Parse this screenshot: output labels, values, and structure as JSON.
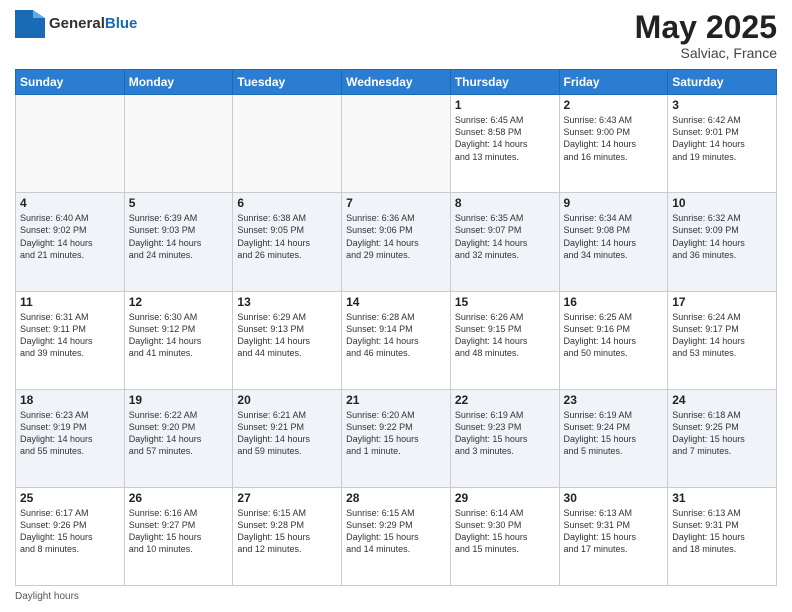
{
  "header": {
    "logo_general": "General",
    "logo_blue": "Blue",
    "month_year": "May 2025",
    "location": "Salviac, France"
  },
  "days_of_week": [
    "Sunday",
    "Monday",
    "Tuesday",
    "Wednesday",
    "Thursday",
    "Friday",
    "Saturday"
  ],
  "footer_text": "Daylight hours",
  "weeks": [
    [
      {
        "num": "",
        "info": ""
      },
      {
        "num": "",
        "info": ""
      },
      {
        "num": "",
        "info": ""
      },
      {
        "num": "",
        "info": ""
      },
      {
        "num": "1",
        "info": "Sunrise: 6:45 AM\nSunset: 8:58 PM\nDaylight: 14 hours\nand 13 minutes."
      },
      {
        "num": "2",
        "info": "Sunrise: 6:43 AM\nSunset: 9:00 PM\nDaylight: 14 hours\nand 16 minutes."
      },
      {
        "num": "3",
        "info": "Sunrise: 6:42 AM\nSunset: 9:01 PM\nDaylight: 14 hours\nand 19 minutes."
      }
    ],
    [
      {
        "num": "4",
        "info": "Sunrise: 6:40 AM\nSunset: 9:02 PM\nDaylight: 14 hours\nand 21 minutes."
      },
      {
        "num": "5",
        "info": "Sunrise: 6:39 AM\nSunset: 9:03 PM\nDaylight: 14 hours\nand 24 minutes."
      },
      {
        "num": "6",
        "info": "Sunrise: 6:38 AM\nSunset: 9:05 PM\nDaylight: 14 hours\nand 26 minutes."
      },
      {
        "num": "7",
        "info": "Sunrise: 6:36 AM\nSunset: 9:06 PM\nDaylight: 14 hours\nand 29 minutes."
      },
      {
        "num": "8",
        "info": "Sunrise: 6:35 AM\nSunset: 9:07 PM\nDaylight: 14 hours\nand 32 minutes."
      },
      {
        "num": "9",
        "info": "Sunrise: 6:34 AM\nSunset: 9:08 PM\nDaylight: 14 hours\nand 34 minutes."
      },
      {
        "num": "10",
        "info": "Sunrise: 6:32 AM\nSunset: 9:09 PM\nDaylight: 14 hours\nand 36 minutes."
      }
    ],
    [
      {
        "num": "11",
        "info": "Sunrise: 6:31 AM\nSunset: 9:11 PM\nDaylight: 14 hours\nand 39 minutes."
      },
      {
        "num": "12",
        "info": "Sunrise: 6:30 AM\nSunset: 9:12 PM\nDaylight: 14 hours\nand 41 minutes."
      },
      {
        "num": "13",
        "info": "Sunrise: 6:29 AM\nSunset: 9:13 PM\nDaylight: 14 hours\nand 44 minutes."
      },
      {
        "num": "14",
        "info": "Sunrise: 6:28 AM\nSunset: 9:14 PM\nDaylight: 14 hours\nand 46 minutes."
      },
      {
        "num": "15",
        "info": "Sunrise: 6:26 AM\nSunset: 9:15 PM\nDaylight: 14 hours\nand 48 minutes."
      },
      {
        "num": "16",
        "info": "Sunrise: 6:25 AM\nSunset: 9:16 PM\nDaylight: 14 hours\nand 50 minutes."
      },
      {
        "num": "17",
        "info": "Sunrise: 6:24 AM\nSunset: 9:17 PM\nDaylight: 14 hours\nand 53 minutes."
      }
    ],
    [
      {
        "num": "18",
        "info": "Sunrise: 6:23 AM\nSunset: 9:19 PM\nDaylight: 14 hours\nand 55 minutes."
      },
      {
        "num": "19",
        "info": "Sunrise: 6:22 AM\nSunset: 9:20 PM\nDaylight: 14 hours\nand 57 minutes."
      },
      {
        "num": "20",
        "info": "Sunrise: 6:21 AM\nSunset: 9:21 PM\nDaylight: 14 hours\nand 59 minutes."
      },
      {
        "num": "21",
        "info": "Sunrise: 6:20 AM\nSunset: 9:22 PM\nDaylight: 15 hours\nand 1 minute."
      },
      {
        "num": "22",
        "info": "Sunrise: 6:19 AM\nSunset: 9:23 PM\nDaylight: 15 hours\nand 3 minutes."
      },
      {
        "num": "23",
        "info": "Sunrise: 6:19 AM\nSunset: 9:24 PM\nDaylight: 15 hours\nand 5 minutes."
      },
      {
        "num": "24",
        "info": "Sunrise: 6:18 AM\nSunset: 9:25 PM\nDaylight: 15 hours\nand 7 minutes."
      }
    ],
    [
      {
        "num": "25",
        "info": "Sunrise: 6:17 AM\nSunset: 9:26 PM\nDaylight: 15 hours\nand 8 minutes."
      },
      {
        "num": "26",
        "info": "Sunrise: 6:16 AM\nSunset: 9:27 PM\nDaylight: 15 hours\nand 10 minutes."
      },
      {
        "num": "27",
        "info": "Sunrise: 6:15 AM\nSunset: 9:28 PM\nDaylight: 15 hours\nand 12 minutes."
      },
      {
        "num": "28",
        "info": "Sunrise: 6:15 AM\nSunset: 9:29 PM\nDaylight: 15 hours\nand 14 minutes."
      },
      {
        "num": "29",
        "info": "Sunrise: 6:14 AM\nSunset: 9:30 PM\nDaylight: 15 hours\nand 15 minutes."
      },
      {
        "num": "30",
        "info": "Sunrise: 6:13 AM\nSunset: 9:31 PM\nDaylight: 15 hours\nand 17 minutes."
      },
      {
        "num": "31",
        "info": "Sunrise: 6:13 AM\nSunset: 9:31 PM\nDaylight: 15 hours\nand 18 minutes."
      }
    ]
  ]
}
